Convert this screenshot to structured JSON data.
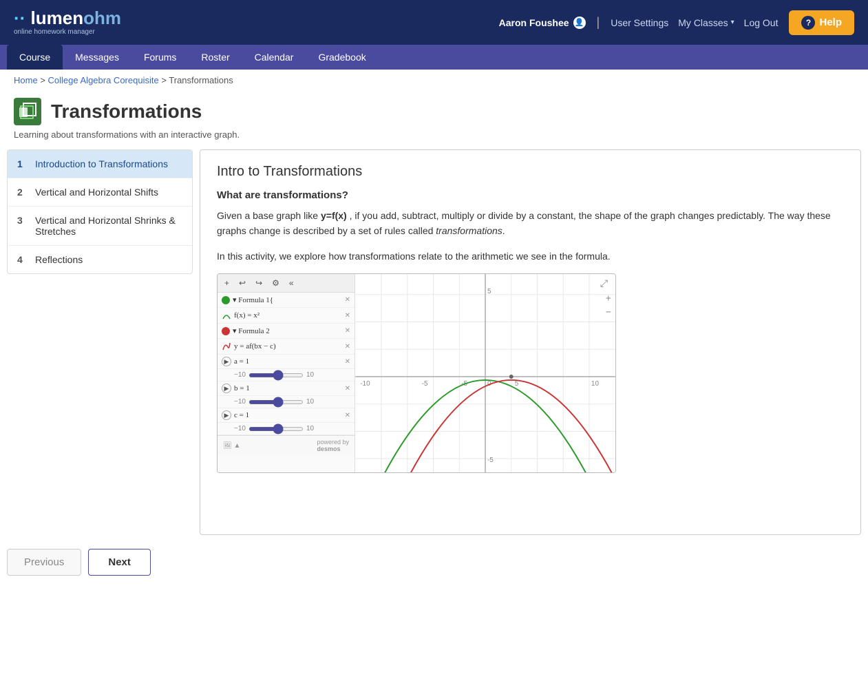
{
  "header": {
    "logo_lumen": "lumen",
    "logo_ohm": "ohm",
    "logo_subtitle": "online homework manager",
    "user_name": "Aaron Foushee",
    "user_settings_label": "User Settings",
    "my_classes_label": "My Classes",
    "logout_label": "Log Out",
    "help_label": "Help"
  },
  "nav": {
    "items": [
      {
        "label": "Course",
        "active": true
      },
      {
        "label": "Messages",
        "active": false
      },
      {
        "label": "Forums",
        "active": false
      },
      {
        "label": "Roster",
        "active": false
      },
      {
        "label": "Calendar",
        "active": false
      },
      {
        "label": "Gradebook",
        "active": false
      }
    ]
  },
  "breadcrumb": {
    "items": [
      "Home",
      "College Algebra Corequisite",
      "Transformations"
    ]
  },
  "page": {
    "title": "Transformations",
    "subtitle": "Learning about transformations with an interactive graph."
  },
  "sidebar": {
    "items": [
      {
        "num": "1",
        "label": "Introduction to Transformations",
        "active": true
      },
      {
        "num": "2",
        "label": "Vertical and Horizontal Shifts",
        "active": false
      },
      {
        "num": "3",
        "label": "Vertical and Horizontal Shrinks & Stretches",
        "active": false
      },
      {
        "num": "4",
        "label": "Reflections",
        "active": false
      }
    ]
  },
  "content": {
    "title": "Intro to Transformations",
    "section_heading": "What are transformations?",
    "paragraph1": "Given a base graph like y=f(x) , if you add, subtract, multiply or divide by a constant, the shape of the graph changes predictably. The way these graphs change is described by a set of rules called transformations.",
    "paragraph1_bold": "y=f(x)",
    "paragraph1_italic": "transformations",
    "paragraph2": "In this activity, we explore how transformations relate to the arithmetic we see in the formula.",
    "graph": {
      "formula1_label": "Formula 1{",
      "formula1_eq": "f(x) = x²",
      "formula2_label": "Formula 2",
      "formula2_eq": "y = af(bx − c)",
      "slider_a": "a = 1",
      "slider_b": "b = 1",
      "slider_c": "c = 1",
      "slider_min": "−10",
      "slider_max": "10",
      "powered_by": "powered by desmos"
    }
  },
  "buttons": {
    "previous_label": "Previous",
    "next_label": "Next"
  }
}
